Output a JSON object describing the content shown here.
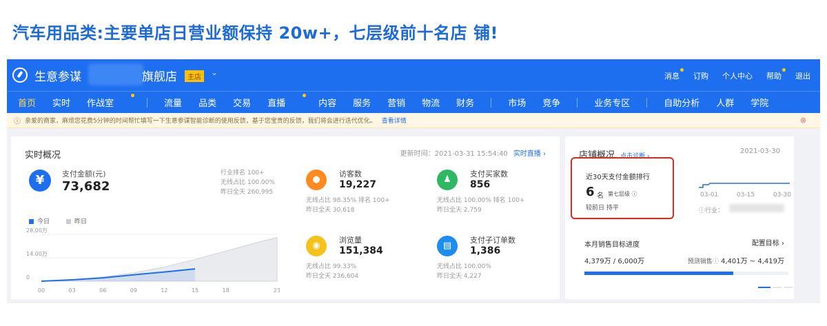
{
  "headline": "汽车用品类:主要单店日营业额保持 20w+，七层级前十名店 铺!",
  "colors": {
    "accent": "#1e6ff0",
    "headline": "#1e6bd6",
    "highlight_box": "#e0261f"
  },
  "app": {
    "brand": "生意参谋",
    "store_suffix": "旗舰店",
    "store_tag": "主店",
    "top_links": [
      "消息",
      "订购",
      "个人中心",
      "帮助",
      "退出"
    ]
  },
  "nav": {
    "group1": [
      "首页",
      "实时",
      "作战室"
    ],
    "group2": [
      "流量",
      "品类",
      "交易",
      "直播",
      "内容",
      "服务",
      "营销",
      "物流",
      "财务"
    ],
    "group3": [
      "市场",
      "竞争"
    ],
    "group4": [
      "业务专区"
    ],
    "group5": [
      "自助分析",
      "人群",
      "学院"
    ]
  },
  "notice": {
    "text": "亲爱的商家，麻烦您花费5分钟的时间帮忙填写一下生意参谋智能诊断的使用反馈，基于您宝贵的反馈，我们将会进行迭代优化。",
    "link": "查看详情"
  },
  "realtime": {
    "title": "实时概况",
    "update_time": "更新时间：2021-03-31 15:54:40",
    "live_link": "实时直播 ›",
    "pay": {
      "label": "支付金额(元)",
      "value": "73,682",
      "stats": [
        "行业排名  100+",
        "无线占比  100.00%",
        "昨日全天  260,995"
      ]
    },
    "legend_today": "今日",
    "legend_yesterday": "昨日",
    "metrics": [
      {
        "label": "访客数",
        "value": "19,227",
        "sub1": "无线占比  98.35%    排名 100+",
        "sub2": "昨日全天  30,618",
        "color": "#ff8a1f",
        "icon": "footprint-icon"
      },
      {
        "label": "支付买家数",
        "value": "856",
        "sub1": "无线占比  100.00%   排名 100+",
        "sub2": "昨日全天  2,759",
        "color": "#2fb862",
        "icon": "users-icon"
      },
      {
        "label": "浏览量",
        "value": "151,384",
        "sub1": "无线占比  99.33%",
        "sub2": "昨日全天  236,604",
        "color": "#f5c21b",
        "icon": "eye-icon"
      },
      {
        "label": "支付子订单数",
        "value": "1,386",
        "sub1": "无线占比  100.00%",
        "sub2": "昨日全天  4,227",
        "color": "#1e8df0",
        "icon": "document-icon"
      }
    ]
  },
  "chart_data": {
    "type": "area",
    "x": [
      "00",
      "03",
      "06",
      "09",
      "12",
      "15",
      "18",
      "23"
    ],
    "y_ticks": [
      "28.00万",
      "14.00万",
      "0"
    ],
    "ylim": [
      0,
      280000
    ],
    "series": [
      {
        "name": "今日",
        "x": [
          0,
          3,
          6,
          9,
          12,
          15
        ],
        "values": [
          0,
          8000,
          20000,
          38000,
          55000,
          73682
        ]
      },
      {
        "name": "昨日",
        "x": [
          0,
          3,
          6,
          9,
          12,
          15,
          18,
          21,
          23
        ],
        "values": [
          0,
          10000,
          25000,
          50000,
          85000,
          130000,
          180000,
          230000,
          260995
        ]
      }
    ]
  },
  "shop": {
    "title": "店铺概况",
    "diag_link": "点击诊断 ›",
    "date": "2021-03-30",
    "rank_title": "近30天支付金额排行",
    "rank_value": "6",
    "rank_unit": "名",
    "rank_level": "第七层级",
    "rank_prev": "较前日  持平",
    "trend_ticks": [
      "03-01",
      "03-15",
      "03-30"
    ],
    "industry_label": "行业：",
    "goal_title": "本月销售目标进度",
    "goal_config": "配置目标 ›",
    "goal_value": "4,379万 / 6,000万",
    "goal_pred_label": "预测销售",
    "goal_pred": "4,401万 ~ 4,419万",
    "goal_progress": 0.73
  }
}
